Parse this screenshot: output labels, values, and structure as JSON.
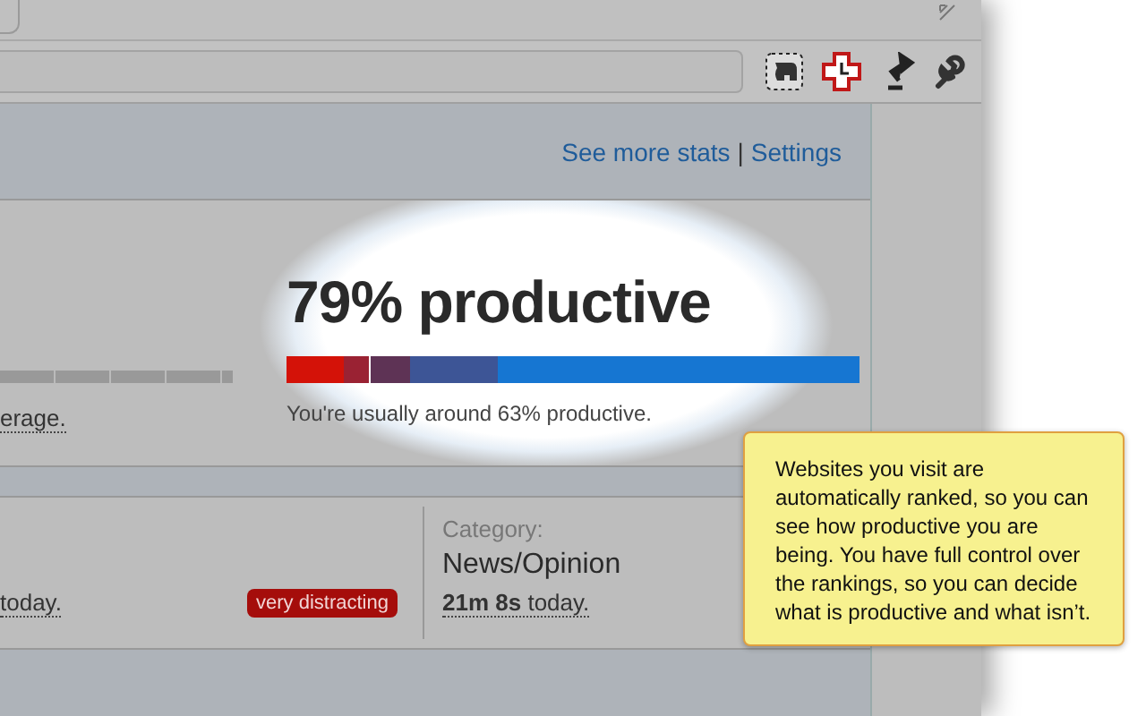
{
  "popup": {
    "links": [
      {
        "label": "See more stats"
      },
      {
        "label": "Settings"
      }
    ],
    "link_separator": "|",
    "left_summary": {
      "text": "erage."
    },
    "summary": {
      "headline": "79% productive",
      "note": "You're usually around 63% productive."
    },
    "site_row": {
      "time": "today.",
      "badge": "very distracting",
      "category_label": "Category:",
      "category": "News/Opinion",
      "category_time": "**21m 8s** today."
    }
  },
  "tooltip": {
    "text": "Websites you visit are automatically ranked, so you can see how productive you are being. You have full control over the rankings, so you can decide what is productive and what isn’t."
  }
}
